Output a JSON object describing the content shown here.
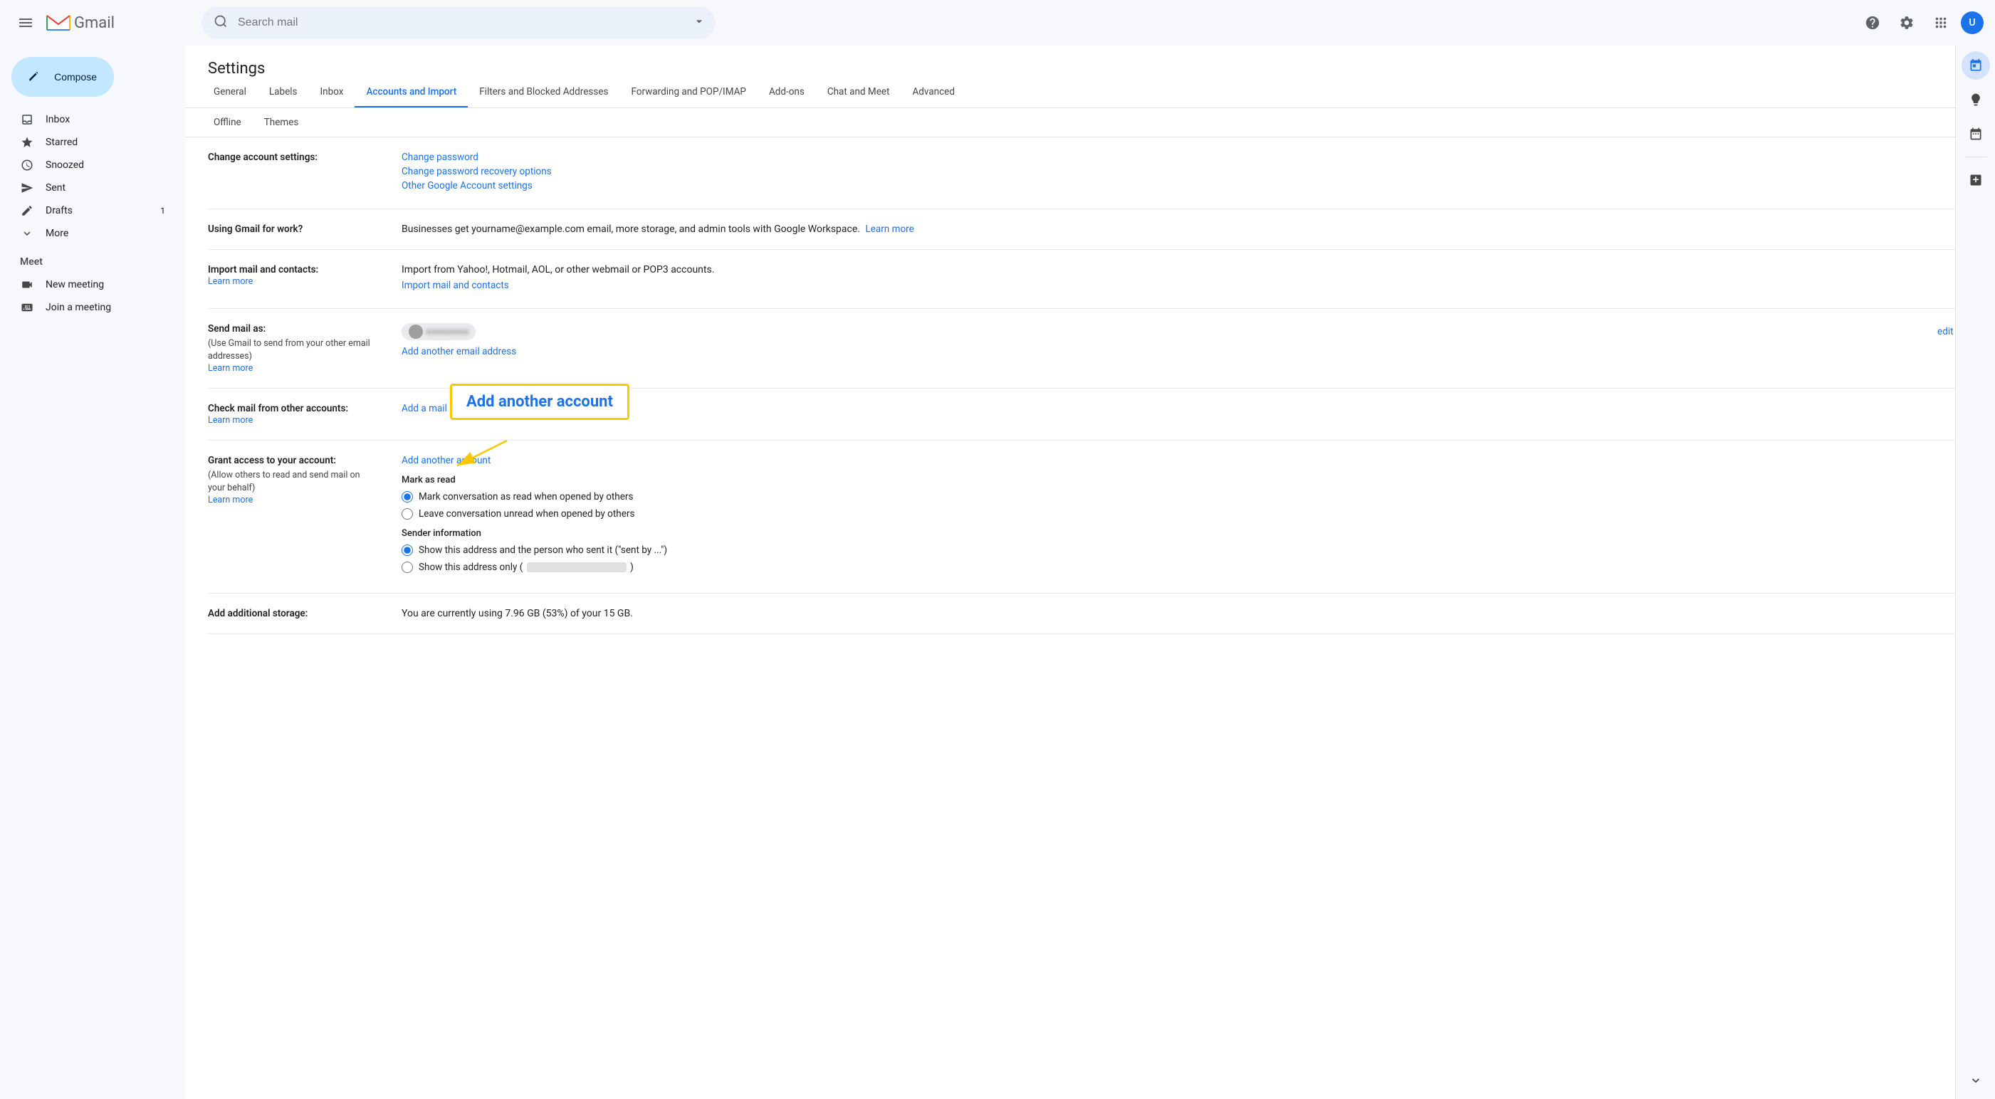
{
  "topbar": {
    "search_placeholder": "Search mail",
    "gmail_label": "Gmail"
  },
  "sidebar": {
    "compose_label": "Compose",
    "nav_items": [
      {
        "id": "inbox",
        "label": "Inbox",
        "icon": "📥",
        "count": ""
      },
      {
        "id": "starred",
        "label": "Starred",
        "icon": "☆",
        "count": ""
      },
      {
        "id": "snoozed",
        "label": "Snoozed",
        "icon": "🕐",
        "count": ""
      },
      {
        "id": "sent",
        "label": "Sent",
        "icon": "➤",
        "count": ""
      },
      {
        "id": "drafts",
        "label": "Drafts",
        "icon": "📄",
        "count": "1"
      },
      {
        "id": "more",
        "label": "More",
        "icon": "▾",
        "count": ""
      }
    ],
    "meet_title": "Meet",
    "meet_items": [
      {
        "id": "new-meeting",
        "label": "New meeting",
        "icon": "📷"
      },
      {
        "id": "join-meeting",
        "label": "Join a meeting",
        "icon": "⌨"
      }
    ]
  },
  "settings": {
    "title": "Settings",
    "tabs": [
      {
        "id": "general",
        "label": "General",
        "active": false
      },
      {
        "id": "labels",
        "label": "Labels",
        "active": false
      },
      {
        "id": "inbox",
        "label": "Inbox",
        "active": false
      },
      {
        "id": "accounts-import",
        "label": "Accounts and Import",
        "active": true
      },
      {
        "id": "filters-blocked",
        "label": "Filters and Blocked Addresses",
        "active": false
      },
      {
        "id": "forwarding-pop-imap",
        "label": "Forwarding and POP/IMAP",
        "active": false
      },
      {
        "id": "add-ons",
        "label": "Add-ons",
        "active": false
      },
      {
        "id": "chat-meet",
        "label": "Chat and Meet",
        "active": false
      },
      {
        "id": "advanced",
        "label": "Advanced",
        "active": false
      }
    ],
    "tabs2": [
      {
        "id": "offline",
        "label": "Offline"
      },
      {
        "id": "themes",
        "label": "Themes"
      }
    ],
    "rows": [
      {
        "id": "change-account",
        "label": "Change account settings:",
        "links": [
          {
            "id": "change-password",
            "text": "Change password"
          },
          {
            "id": "change-recovery",
            "text": "Change password recovery options"
          },
          {
            "id": "google-account",
            "text": "Other Google Account settings"
          }
        ]
      },
      {
        "id": "gmail-work",
        "label": "Using Gmail for work?",
        "content": "Businesses get yourname@example.com email, more storage, and admin tools with Google Workspace.",
        "learn_more": "Learn more"
      },
      {
        "id": "import-mail",
        "label": "Import mail and contacts:",
        "learn_more": "Learn more",
        "content_text": "Import from Yahoo!, Hotmail, AOL, or other webmail or POP3 accounts.",
        "link": "Import mail and contacts"
      },
      {
        "id": "send-mail-as",
        "label": "Send mail as:",
        "sublabel": "(Use Gmail to send from your other email addresses)",
        "learn_more": "Learn more",
        "edit_info": "edit info",
        "email_chip_placeholder": "●●●●●●●●",
        "add_link": "Add another email address"
      },
      {
        "id": "check-mail",
        "label": "Check mail from other accounts:",
        "learn_more": "Learn more",
        "add_link": "Add a mail account"
      },
      {
        "id": "grant-access",
        "label": "Grant access to your account:",
        "sublabel": "(Allow others to read and send mail on your behalf)",
        "learn_more": "Learn more",
        "add_link": "Add another account",
        "mark_as_read_title": "Mark as read",
        "radio1": "Mark conversation as read when opened by others",
        "radio2": "Leave conversation unread when opened by others",
        "sender_info_title": "Sender information",
        "radio3": "Show this address and the person who sent it (\"sent by ...\")",
        "radio4": "Show this address only (",
        "radio4_end": ")"
      },
      {
        "id": "add-storage",
        "label": "Add additional storage:",
        "content": "You are currently using 7.96 GB (53%) of your 15 GB."
      }
    ]
  },
  "annotation": {
    "text": "Add another account"
  },
  "right_panel": {
    "icons": [
      "📅",
      "📝",
      "✅"
    ]
  }
}
